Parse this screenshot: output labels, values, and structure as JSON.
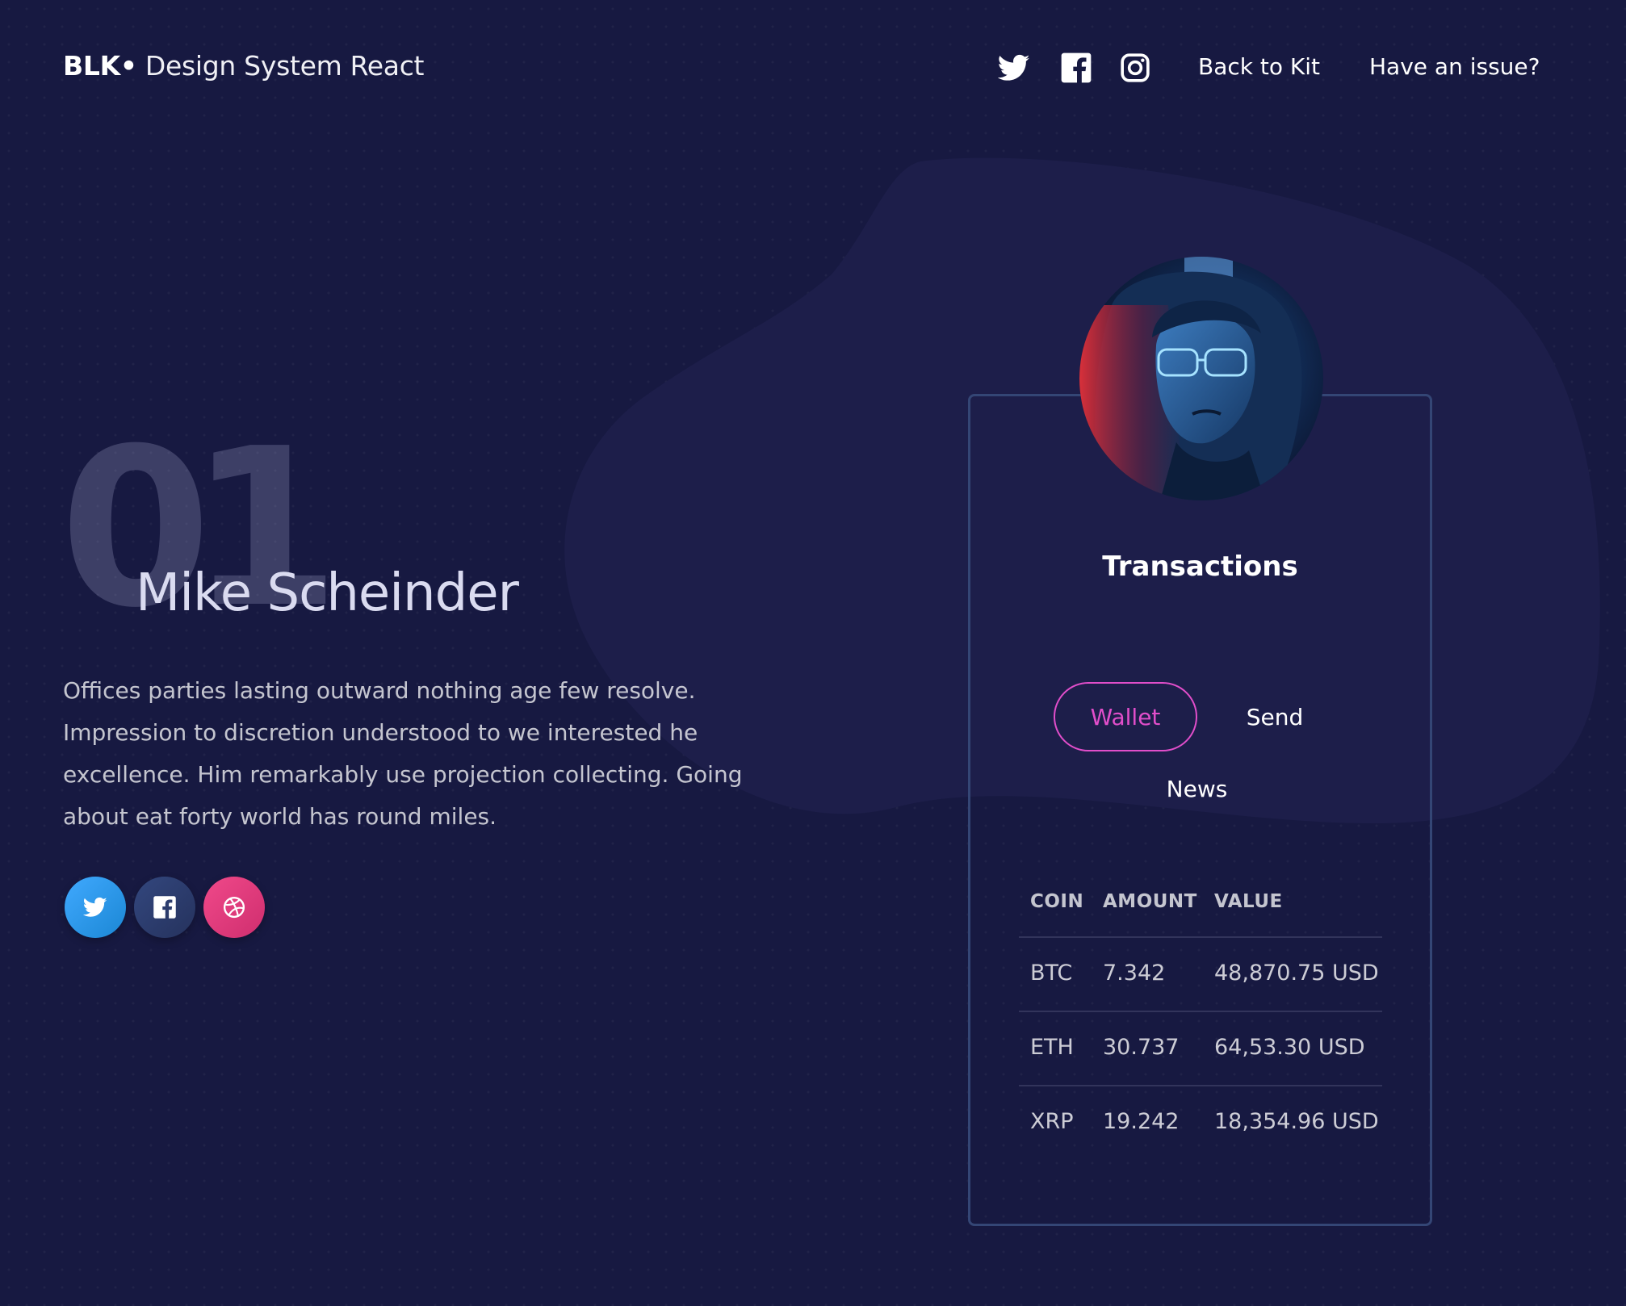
{
  "navbar": {
    "brand_bold": "BLK•",
    "brand_rest": "Design System React",
    "icons": [
      "twitter-icon",
      "facebook-square-icon",
      "instagram-icon"
    ],
    "links": [
      "Back to Kit",
      "Have an issue?"
    ]
  },
  "hero": {
    "number": "01",
    "title": "Mike Scheinder",
    "description": "Offices parties lasting outward nothing age few resolve. Impression to discretion understood to we interested he excellence. Him remarkably use projection collecting. Going about eat forty world has round miles.",
    "social_buttons": [
      {
        "icon": "twitter-icon",
        "color": "#1da1f2"
      },
      {
        "icon": "facebook-square-icon",
        "color": "#3b5998"
      },
      {
        "icon": "dribbble-icon",
        "color": "#ea4c89"
      }
    ]
  },
  "card": {
    "title": "Transactions",
    "tabs": [
      "Wallet",
      "Send",
      "News"
    ],
    "active_tab": "Wallet",
    "table": {
      "headers": [
        "COIN",
        "AMOUNT",
        "VALUE"
      ],
      "rows": [
        [
          "BTC",
          "7.342",
          "48,870.75 USD"
        ],
        [
          "ETH",
          "30.737",
          "64,53.30 USD"
        ],
        [
          "XRP",
          "19.242",
          "18,354.96 USD"
        ]
      ]
    }
  },
  "colors": {
    "background": "#171941",
    "primary": "#e14eca",
    "card_border": "#344675"
  }
}
